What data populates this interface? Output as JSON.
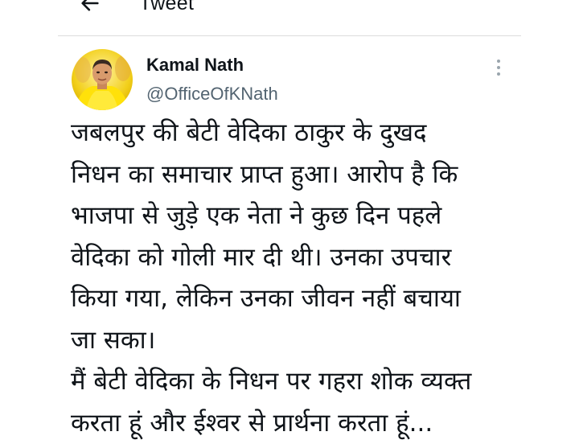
{
  "header": {
    "title": "Tweet",
    "back_icon": "arrow-left-icon"
  },
  "tweet": {
    "author_name": "Kamal Nath",
    "author_handle": "@OfficeOfKNath",
    "more_icon": "more-vertical-icon",
    "avatar_icon": "profile-photo",
    "lines": [
      "जबलपुर की बेटी वेदिका ठाकुर के दुखद",
      "निधन का समाचार प्राप्त हुआ। आरोप है कि",
      "भाजपा से जुड़े एक नेता ने कुछ दिन पहले",
      "वेदिका को गोली मार दी थी। उनका उपचार",
      "किया गया, लेकिन उनका जीवन नहीं बचाया",
      "जा सका।",
      "मैं बेटी वेदिका के निधन पर गहरा शोक व्यक्त",
      "करता हूं और ईश्वर से प्रार्थना करता हूं..."
    ]
  },
  "colors": {
    "text": "#0f1419",
    "secondary": "#536471",
    "divider": "#dcdcdc",
    "avatar_bg": "#f5d90a"
  }
}
